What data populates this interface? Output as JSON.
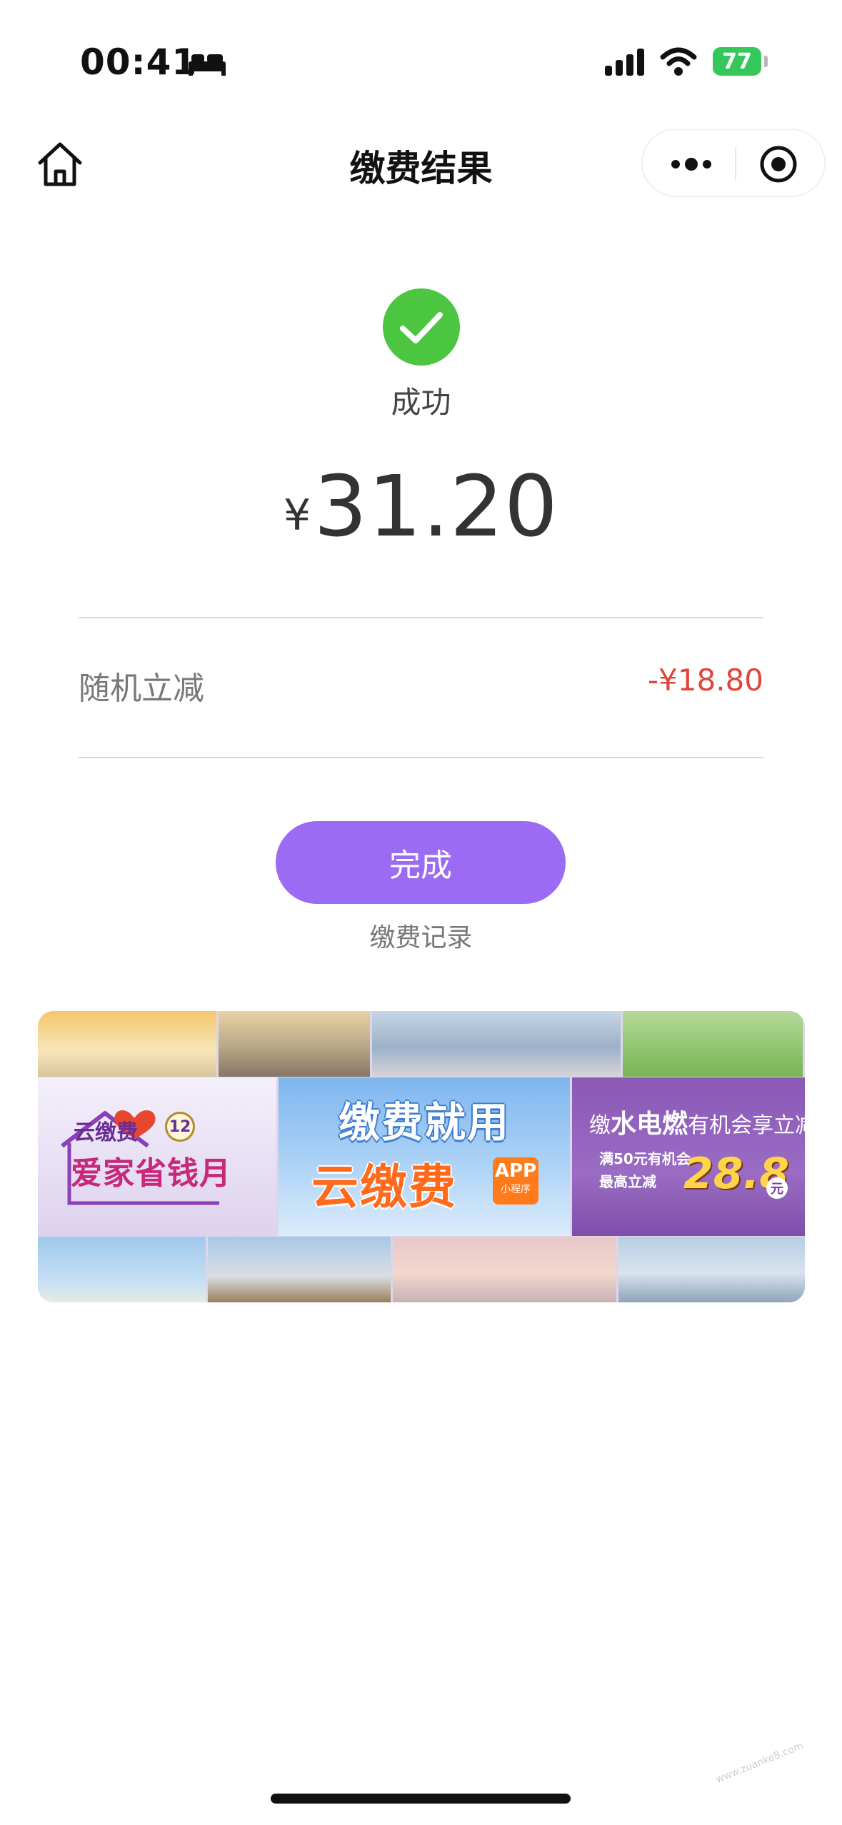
{
  "status_bar": {
    "time": "00:41",
    "battery": "77",
    "icons": [
      "sleep-icon",
      "signal-icon",
      "wifi-icon",
      "battery-icon"
    ]
  },
  "nav": {
    "title": "缴费结果",
    "icons": [
      "home-icon",
      "more-icon",
      "target-icon"
    ]
  },
  "result": {
    "status_text": "成功",
    "currency_symbol": "¥",
    "amount": "31.20",
    "success_color": "#4cc640"
  },
  "discount": {
    "label": "随机立减",
    "value": "-¥18.80",
    "value_color": "#e0453b"
  },
  "actions": {
    "done_label": "完成",
    "done_color": "#9b6cf3",
    "record_label": "缴费记录"
  },
  "banner": {
    "left_brand": "云缴费",
    "left_badge": "12",
    "left_slogan": "爱家省钱月",
    "mid_line1": "缴费就用",
    "mid_line2": "云缴费",
    "mid_app": "APP",
    "mid_app_sub": "小程序",
    "right_prefix": "缴",
    "right_bold": "水电燃",
    "right_suffix": "有机会享立减",
    "right_line2": "满50元有机会",
    "right_line3": "最高立减",
    "right_number": "28.8",
    "right_unit": "元"
  },
  "watermark": "www.zuanke8.com"
}
